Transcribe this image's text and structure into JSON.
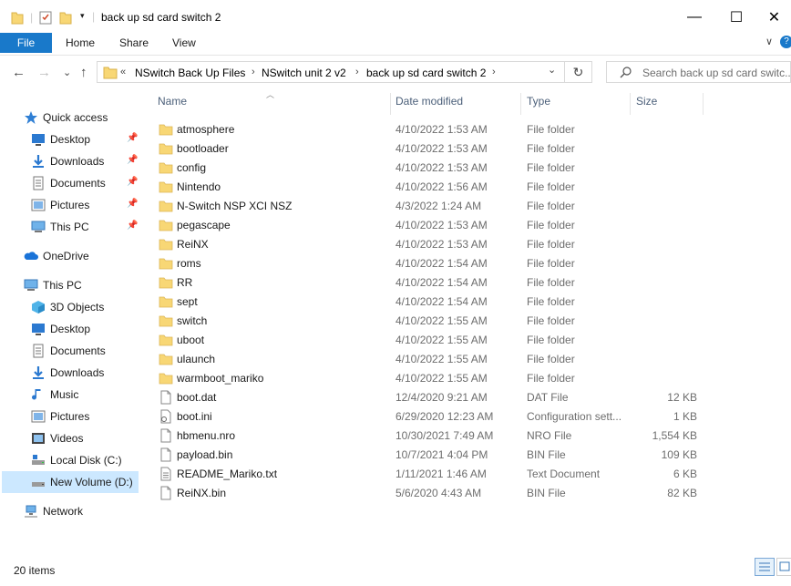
{
  "window": {
    "title": "back up sd card switch 2",
    "minimize_glyph": "—",
    "maximize_glyph": "☐",
    "close_glyph": "✕"
  },
  "ribbon": {
    "tabs": [
      "File",
      "Home",
      "Share",
      "View"
    ],
    "collapse_glyph": "∨",
    "help_glyph": "?"
  },
  "address": {
    "overflow": "«",
    "crumbs": [
      "NSwitch Back Up Files",
      "NSwitch unit 2 v2",
      "back up sd card switch 2"
    ],
    "separator": "›",
    "dropdown_glyph": "⌄",
    "refresh_glyph": "↻"
  },
  "search": {
    "placeholder": "Search back up sd card switc..."
  },
  "nav_glyphs": {
    "back": "←",
    "forward": "→",
    "recent": "⌄",
    "up": "↑"
  },
  "sidebar": {
    "quick_access": "Quick access",
    "pinned": [
      {
        "label": "Desktop",
        "icon": "desktop-icon"
      },
      {
        "label": "Downloads",
        "icon": "downloads-icon"
      },
      {
        "label": "Documents",
        "icon": "documents-icon"
      },
      {
        "label": "Pictures",
        "icon": "pictures-icon"
      },
      {
        "label": "This PC",
        "icon": "this-pc-icon"
      }
    ],
    "onedrive": "OneDrive",
    "this_pc": "This PC",
    "this_pc_items": [
      {
        "label": "3D Objects",
        "icon": "3d-objects-icon"
      },
      {
        "label": "Desktop",
        "icon": "desktop-icon"
      },
      {
        "label": "Documents",
        "icon": "documents-icon"
      },
      {
        "label": "Downloads",
        "icon": "downloads-icon"
      },
      {
        "label": "Music",
        "icon": "music-icon"
      },
      {
        "label": "Pictures",
        "icon": "pictures-icon"
      },
      {
        "label": "Videos",
        "icon": "videos-icon"
      },
      {
        "label": "Local Disk (C:)",
        "icon": "local-disk-icon"
      },
      {
        "label": "New Volume (D:)",
        "icon": "drive-icon"
      }
    ],
    "network": "Network"
  },
  "columns": {
    "name": "Name",
    "date": "Date modified",
    "type": "Type",
    "size": "Size"
  },
  "files": [
    {
      "name": "atmosphere",
      "date": "4/10/2022 1:53 AM",
      "type": "File folder",
      "size": "",
      "kind": "folder"
    },
    {
      "name": "bootloader",
      "date": "4/10/2022 1:53 AM",
      "type": "File folder",
      "size": "",
      "kind": "folder"
    },
    {
      "name": "config",
      "date": "4/10/2022 1:53 AM",
      "type": "File folder",
      "size": "",
      "kind": "folder"
    },
    {
      "name": "Nintendo",
      "date": "4/10/2022 1:56 AM",
      "type": "File folder",
      "size": "",
      "kind": "folder"
    },
    {
      "name": "N-Switch NSP XCI NSZ",
      "date": "4/3/2022 1:24 AM",
      "type": "File folder",
      "size": "",
      "kind": "folder"
    },
    {
      "name": "pegascape",
      "date": "4/10/2022 1:53 AM",
      "type": "File folder",
      "size": "",
      "kind": "folder"
    },
    {
      "name": "ReiNX",
      "date": "4/10/2022 1:53 AM",
      "type": "File folder",
      "size": "",
      "kind": "folder"
    },
    {
      "name": "roms",
      "date": "4/10/2022 1:54 AM",
      "type": "File folder",
      "size": "",
      "kind": "folder"
    },
    {
      "name": "RR",
      "date": "4/10/2022 1:54 AM",
      "type": "File folder",
      "size": "",
      "kind": "folder"
    },
    {
      "name": "sept",
      "date": "4/10/2022 1:54 AM",
      "type": "File folder",
      "size": "",
      "kind": "folder"
    },
    {
      "name": "switch",
      "date": "4/10/2022 1:55 AM",
      "type": "File folder",
      "size": "",
      "kind": "folder"
    },
    {
      "name": "uboot",
      "date": "4/10/2022 1:55 AM",
      "type": "File folder",
      "size": "",
      "kind": "folder"
    },
    {
      "name": "ulaunch",
      "date": "4/10/2022 1:55 AM",
      "type": "File folder",
      "size": "",
      "kind": "folder"
    },
    {
      "name": "warmboot_mariko",
      "date": "4/10/2022 1:55 AM",
      "type": "File folder",
      "size": "",
      "kind": "folder"
    },
    {
      "name": "boot.dat",
      "date": "12/4/2020 9:21 AM",
      "type": "DAT File",
      "size": "12 KB",
      "kind": "file"
    },
    {
      "name": "boot.ini",
      "date": "6/29/2020 12:23 AM",
      "type": "Configuration sett...",
      "size": "1 KB",
      "kind": "config"
    },
    {
      "name": "hbmenu.nro",
      "date": "10/30/2021 7:49 AM",
      "type": "NRO File",
      "size": "1,554 KB",
      "kind": "file"
    },
    {
      "name": "payload.bin",
      "date": "10/7/2021 4:04 PM",
      "type": "BIN File",
      "size": "109 KB",
      "kind": "file"
    },
    {
      "name": "README_Mariko.txt",
      "date": "1/11/2021 1:46 AM",
      "type": "Text Document",
      "size": "6 KB",
      "kind": "text"
    },
    {
      "name": "ReiNX.bin",
      "date": "5/6/2020 4:43 AM",
      "type": "BIN File",
      "size": "82 KB",
      "kind": "file"
    }
  ],
  "status": {
    "item_count": "20 items"
  },
  "colors": {
    "accent": "#1979ca",
    "folder": "#f8d775",
    "selection": "#cce8ff",
    "header_text": "#4c607a"
  }
}
